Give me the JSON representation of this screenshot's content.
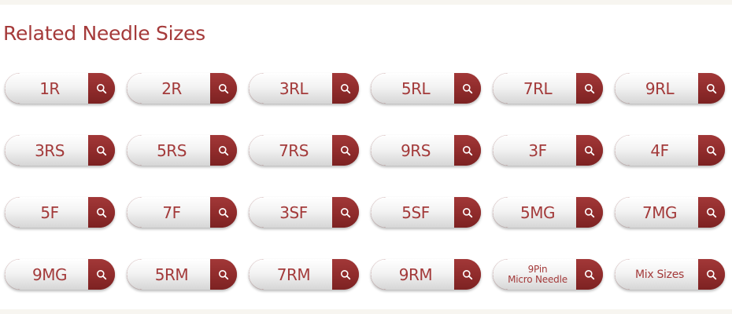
{
  "section": {
    "title": "Related Needle Sizes"
  },
  "needles": [
    {
      "label": "1R"
    },
    {
      "label": "2R"
    },
    {
      "label": "3RL"
    },
    {
      "label": "5RL"
    },
    {
      "label": "7RL"
    },
    {
      "label": "9RL"
    },
    {
      "label": "3RS"
    },
    {
      "label": "5RS"
    },
    {
      "label": "7RS"
    },
    {
      "label": "9RS"
    },
    {
      "label": "3F"
    },
    {
      "label": "4F"
    },
    {
      "label": "5F"
    },
    {
      "label": "7F"
    },
    {
      "label": "3SF"
    },
    {
      "label": "5SF"
    },
    {
      "label": "5MG"
    },
    {
      "label": "7MG"
    },
    {
      "label": "9MG"
    },
    {
      "label": "5RM"
    },
    {
      "label": "7RM"
    },
    {
      "label": "9RM"
    },
    {
      "label": "9Pin\nMicro Needle"
    },
    {
      "label": "Mix Sizes"
    }
  ],
  "icon": "search-icon",
  "colors": {
    "accent": "#a53a3a",
    "button_dark": "#8f2b2b"
  }
}
